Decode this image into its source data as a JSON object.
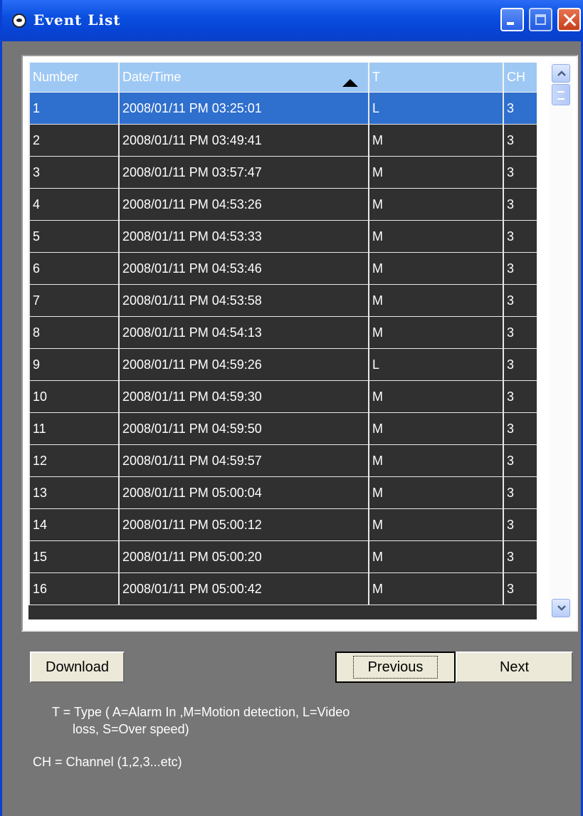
{
  "window": {
    "title": "Event List"
  },
  "table": {
    "columns": [
      "Number",
      "Date/Time",
      "T",
      "CH"
    ],
    "sort_column": "Date/Time",
    "selected_row": 1,
    "rows": [
      {
        "number": "1",
        "datetime": "2008/01/11 PM 03:25:01",
        "type": "L",
        "ch": "3"
      },
      {
        "number": "2",
        "datetime": "2008/01/11 PM 03:49:41",
        "type": "M",
        "ch": "3"
      },
      {
        "number": "3",
        "datetime": "2008/01/11 PM 03:57:47",
        "type": "M",
        "ch": "3"
      },
      {
        "number": "4",
        "datetime": "2008/01/11 PM 04:53:26",
        "type": "M",
        "ch": "3"
      },
      {
        "number": "5",
        "datetime": "2008/01/11 PM 04:53:33",
        "type": "M",
        "ch": "3"
      },
      {
        "number": "6",
        "datetime": "2008/01/11 PM 04:53:46",
        "type": "M",
        "ch": "3"
      },
      {
        "number": "7",
        "datetime": "2008/01/11 PM 04:53:58",
        "type": "M",
        "ch": "3"
      },
      {
        "number": "8",
        "datetime": "2008/01/11 PM 04:54:13",
        "type": "M",
        "ch": "3"
      },
      {
        "number": "9",
        "datetime": "2008/01/11 PM 04:59:26",
        "type": "L",
        "ch": "3"
      },
      {
        "number": "10",
        "datetime": "2008/01/11 PM 04:59:30",
        "type": "M",
        "ch": "3"
      },
      {
        "number": "11",
        "datetime": "2008/01/11 PM 04:59:50",
        "type": "M",
        "ch": "3"
      },
      {
        "number": "12",
        "datetime": "2008/01/11 PM 04:59:57",
        "type": "M",
        "ch": "3"
      },
      {
        "number": "13",
        "datetime": "2008/01/11 PM 05:00:04",
        "type": "M",
        "ch": "3"
      },
      {
        "number": "14",
        "datetime": "2008/01/11 PM 05:00:12",
        "type": "M",
        "ch": "3"
      },
      {
        "number": "15",
        "datetime": "2008/01/11 PM 05:00:20",
        "type": "M",
        "ch": "3"
      },
      {
        "number": "16",
        "datetime": "2008/01/11 PM 05:00:42",
        "type": "M",
        "ch": "3"
      }
    ]
  },
  "buttons": {
    "download": "Download",
    "previous": "Previous",
    "next": "Next"
  },
  "legend": {
    "type_line1": "T = Type ( A=Alarm In ,M=Motion detection, L=Video",
    "type_line2": "loss, S=Over speed)",
    "channel": "CH = Channel (1,2,3...etc)"
  },
  "colors": {
    "titlebar": "#0745d6",
    "header_bg": "#9ec8f4",
    "row_bg": "#303030",
    "selected_bg": "#2f6fcd",
    "window_bg": "#767676"
  },
  "icons": {
    "app": "app-icon",
    "minimize": "minimize-icon",
    "maximize": "maximize-icon",
    "close": "close-icon",
    "sort": "sort-ascending-icon",
    "scroll_up": "chevron-up-icon",
    "scroll_down": "chevron-down-icon"
  }
}
